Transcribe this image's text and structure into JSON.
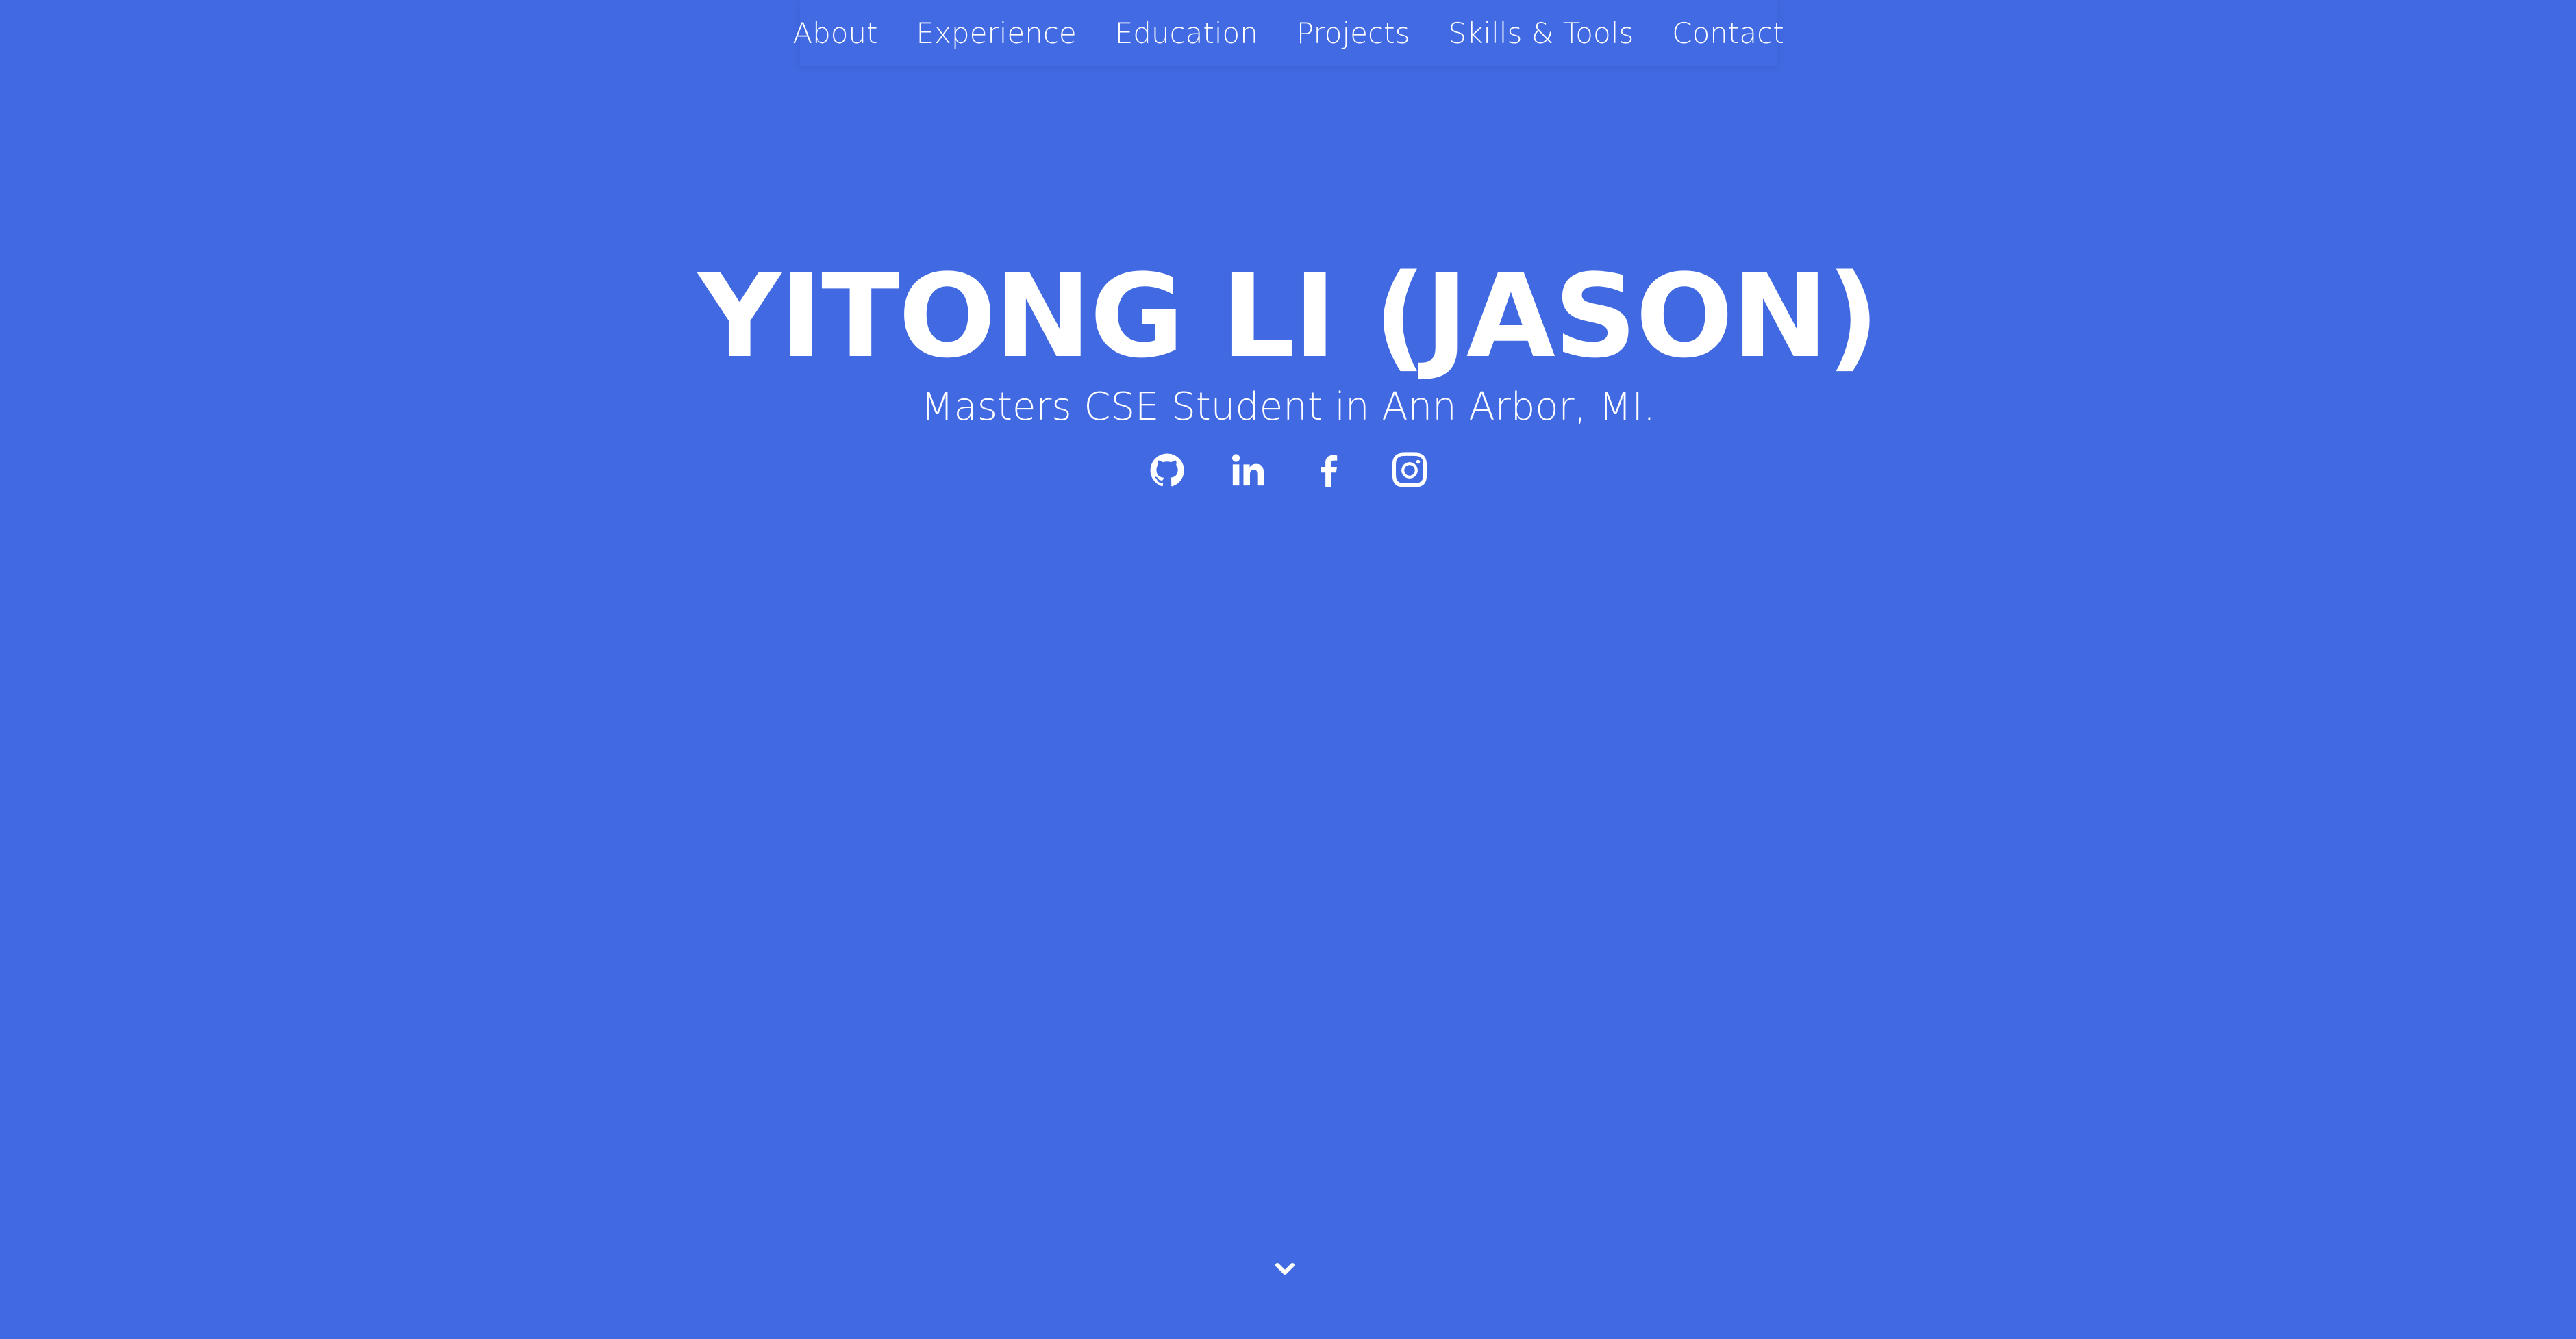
{
  "theme": {
    "background": "#4169e1",
    "text": "#ffffff"
  },
  "nav": {
    "items": [
      {
        "label": "About"
      },
      {
        "label": "Experience"
      },
      {
        "label": "Education"
      },
      {
        "label": "Projects"
      },
      {
        "label": "Skills & Tools"
      },
      {
        "label": "Contact"
      }
    ]
  },
  "hero": {
    "title": "YITONG LI (JASON)",
    "subtitle": "Masters CSE Student in Ann Arbor, MI."
  },
  "socials": [
    {
      "icon": "github-icon"
    },
    {
      "icon": "linkedin-icon"
    },
    {
      "icon": "facebook-icon"
    },
    {
      "icon": "instagram-icon"
    }
  ],
  "scroll": {
    "icon": "chevron-down-icon"
  }
}
